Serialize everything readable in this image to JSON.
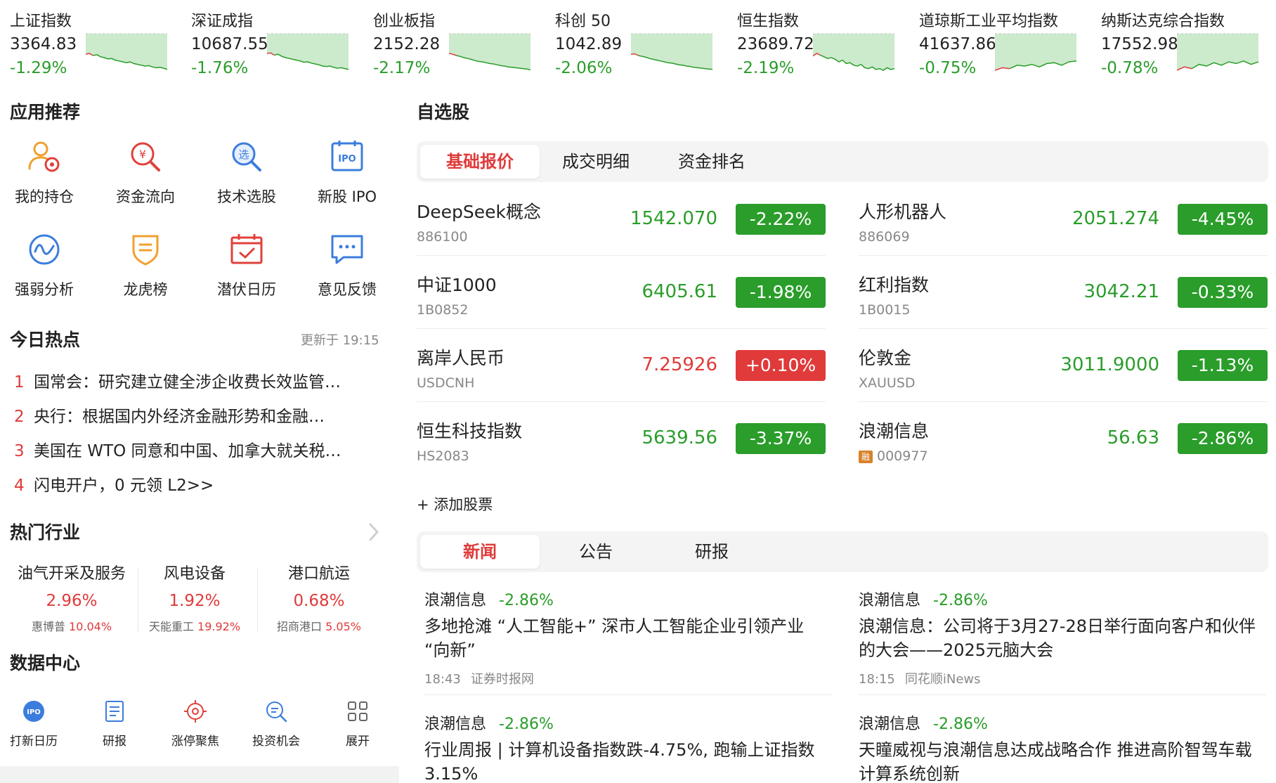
{
  "indices": [
    {
      "name": "上证指数",
      "value": "3364.83",
      "change": "-1.29%",
      "spark": [
        52,
        50,
        55,
        53,
        58,
        60,
        63,
        62,
        66,
        68,
        70,
        72,
        70,
        74,
        76,
        78,
        80,
        79,
        82,
        84,
        83,
        85,
        88
      ]
    },
    {
      "name": "深证成指",
      "value": "10687.55",
      "change": "-1.76%",
      "spark": [
        50,
        49,
        54,
        52,
        57,
        60,
        62,
        64,
        66,
        68,
        71,
        70,
        73,
        75,
        77,
        80,
        81,
        80,
        83,
        85,
        84,
        86,
        88
      ]
    },
    {
      "name": "创业板指",
      "value": "2152.28",
      "change": "-2.17%",
      "spark": [
        50,
        52,
        55,
        57,
        60,
        62,
        64,
        67,
        69,
        70,
        72,
        74,
        75,
        77,
        79,
        80,
        82,
        83,
        84,
        85,
        86,
        87,
        89
      ]
    },
    {
      "name": "科创 50",
      "value": "1042.89",
      "change": "-2.06%",
      "spark": [
        52,
        51,
        55,
        57,
        59,
        62,
        64,
        66,
        68,
        70,
        72,
        73,
        75,
        77,
        78,
        80,
        81,
        83,
        84,
        85,
        86,
        87,
        88
      ]
    },
    {
      "name": "恒生指数",
      "value": "23689.72",
      "change": "-2.19%",
      "spark": [
        56,
        50,
        54,
        58,
        62,
        60,
        64,
        70,
        66,
        74,
        72,
        78,
        80,
        76,
        84,
        86,
        82,
        88,
        86,
        90,
        84,
        88,
        86
      ]
    },
    {
      "name": "道琼斯工业平均指数",
      "value": "41637.86",
      "change": "-0.75%",
      "spark": [
        90,
        84,
        86,
        78,
        80,
        76,
        82,
        74,
        72,
        78,
        70,
        68
      ]
    },
    {
      "name": "纳斯达克综合指数",
      "value": "17552.98",
      "change": "-0.78%",
      "spark": [
        90,
        82,
        86,
        76,
        80,
        72,
        78,
        70,
        74,
        68,
        76,
        70
      ]
    }
  ],
  "apps": {
    "title": "应用推荐",
    "items": [
      {
        "label": "我的持仓",
        "icon": "portfolio-icon"
      },
      {
        "label": "资金流向",
        "icon": "fund-flow-icon"
      },
      {
        "label": "技术选股",
        "icon": "stock-picker-icon"
      },
      {
        "label": "新股 IPO",
        "icon": "ipo-icon"
      },
      {
        "label": "强弱分析",
        "icon": "strength-analysis-icon"
      },
      {
        "label": "龙虎榜",
        "icon": "dragon-tiger-icon"
      },
      {
        "label": "潜伏日历",
        "icon": "calendar-icon"
      },
      {
        "label": "意见反馈",
        "icon": "feedback-icon"
      }
    ]
  },
  "hot": {
    "title": "今日热点",
    "updated": "更新于 19:15",
    "items": [
      {
        "rank": "1",
        "text": "国常会：研究建立健全涉企收费长效监管…"
      },
      {
        "rank": "2",
        "text": "央行：根据国内外经济金融形势和金融…"
      },
      {
        "rank": "3",
        "text": "美国在 WTO 同意和中国、加拿大就关税…"
      },
      {
        "rank": "4",
        "text": "闪电开户，0 元领 L2>>"
      }
    ]
  },
  "industry": {
    "title": "热门行业",
    "items": [
      {
        "name": "油气开采及服务",
        "pct": "2.96%",
        "lead": "惠博普",
        "lead_pct": "10.04%"
      },
      {
        "name": "风电设备",
        "pct": "1.92%",
        "lead": "天能重工",
        "lead_pct": "19.92%"
      },
      {
        "name": "港口航运",
        "pct": "0.68%",
        "lead": "招商港口",
        "lead_pct": "5.05%"
      }
    ]
  },
  "data_center": {
    "title": "数据中心",
    "items": [
      {
        "label": "打新日历",
        "icon": "ipo-calendar-icon",
        "badge": "IPO"
      },
      {
        "label": "研报",
        "icon": "research-report-icon"
      },
      {
        "label": "涨停聚焦",
        "icon": "target-icon"
      },
      {
        "label": "投资机会",
        "icon": "search-icon"
      },
      {
        "label": "展开",
        "icon": "grid-icon"
      }
    ]
  },
  "watchlist": {
    "title": "自选股",
    "tabs": [
      "基础报价",
      "成交明细",
      "资金排名"
    ],
    "active_tab": 0,
    "stocks": [
      {
        "name": "DeepSeek概念",
        "code": "886100",
        "price": "1542.070",
        "change": "-2.22%",
        "up": false,
        "margin": false
      },
      {
        "name": "人形机器人",
        "code": "886069",
        "price": "2051.274",
        "change": "-4.45%",
        "up": false,
        "margin": false
      },
      {
        "name": "中证1000",
        "code": "1B0852",
        "price": "6405.61",
        "change": "-1.98%",
        "up": false,
        "margin": false
      },
      {
        "name": "红利指数",
        "code": "1B0015",
        "price": "3042.21",
        "change": "-0.33%",
        "up": false,
        "margin": false
      },
      {
        "name": "离岸人民币",
        "code": "USDCNH",
        "price": "7.25926",
        "change": "+0.10%",
        "up": true,
        "margin": false
      },
      {
        "name": "伦敦金",
        "code": "XAUUSD",
        "price": "3011.9000",
        "change": "-1.13%",
        "up": false,
        "margin": false
      },
      {
        "name": "恒生科技指数",
        "code": "HS2083",
        "price": "5639.56",
        "change": "-3.37%",
        "up": false,
        "margin": false
      },
      {
        "name": "浪潮信息",
        "code": "000977",
        "price": "56.63",
        "change": "-2.86%",
        "up": false,
        "margin": true,
        "margin_label": "融"
      }
    ],
    "add_label": "+ 添加股票"
  },
  "news": {
    "tabs": [
      "新闻",
      "公告",
      "研报"
    ],
    "active_tab": 0,
    "items": [
      {
        "stock": "浪潮信息",
        "change": "-2.86%",
        "title": "多地抢滩 “人工智能+” 深市人工智能企业引领产业 “向新”",
        "time": "18:43",
        "source": "证券时报网"
      },
      {
        "stock": "浪潮信息",
        "change": "-2.86%",
        "title": "浪潮信息：公司将于3月27-28日举行面向客户和伙伴的大会——2025元脑大会",
        "time": "18:15",
        "source": "同花顺iNews"
      },
      {
        "stock": "浪潮信息",
        "change": "-2.86%",
        "title": "行业周报 | 计算机设备指数跌-4.75%, 跑输上证指数3.15%",
        "time": "",
        "source": ""
      },
      {
        "stock": "浪潮信息",
        "change": "-2.86%",
        "title": "天瞳威视与浪潮信息达成战略合作 推进高阶智驾车载计算系统创新",
        "time": "",
        "source": ""
      }
    ]
  },
  "colors": {
    "up": "#e03a3a",
    "down": "#2a9d2a",
    "icon_blue": "#3b7ddd",
    "icon_red": "#e0413a",
    "icon_orange": "#f0a030"
  }
}
